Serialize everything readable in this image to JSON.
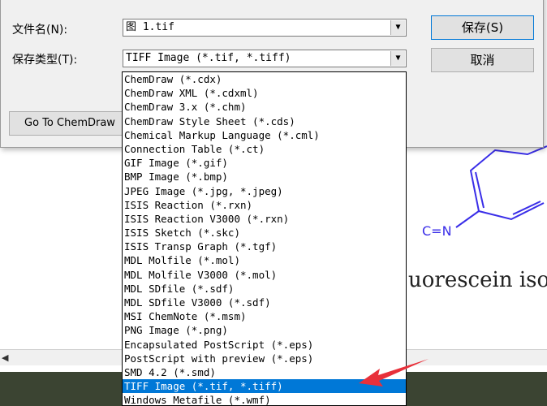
{
  "document": {
    "visible_text": "uorescein isot",
    "molecule_label": "C=N"
  },
  "dialog": {
    "filename_label": "文件名(N):",
    "filename_value": "图 1.tif",
    "filetype_label": "保存类型(T):",
    "filetype_value": "TIFF Image (*.tif, *.tiff)",
    "save_button": "保存(S)",
    "cancel_button": "取消",
    "goto_button": "Go To ChemDraw"
  },
  "filetype_options": [
    "ChemDraw (*.cdx)",
    "ChemDraw XML (*.cdxml)",
    "ChemDraw 3.x (*.chm)",
    "ChemDraw Style Sheet (*.cds)",
    "Chemical Markup Language (*.cml)",
    "Connection Table (*.ct)",
    "GIF Image (*.gif)",
    "BMP Image (*.bmp)",
    "JPEG Image (*.jpg, *.jpeg)",
    "ISIS Reaction (*.rxn)",
    "ISIS Reaction V3000 (*.rxn)",
    "ISIS Sketch (*.skc)",
    "ISIS Transp Graph (*.tgf)",
    "MDL Molfile (*.mol)",
    "MDL Molfile V3000 (*.mol)",
    "MDL SDfile (*.sdf)",
    "MDL SDfile V3000 (*.sdf)",
    "MSI ChemNote (*.msm)",
    "PNG Image (*.png)",
    "Encapsulated PostScript (*.eps)",
    "PostScript with preview (*.eps)",
    "SMD 4.2 (*.smd)",
    "TIFF Image (*.tif, *.tiff)",
    "Windows Metafile (*.wmf)"
  ],
  "selected_index": 22,
  "colors": {
    "selection": "#0078d7",
    "annotation_arrow": "#e8303a",
    "molecule": "#3a2ee8"
  }
}
